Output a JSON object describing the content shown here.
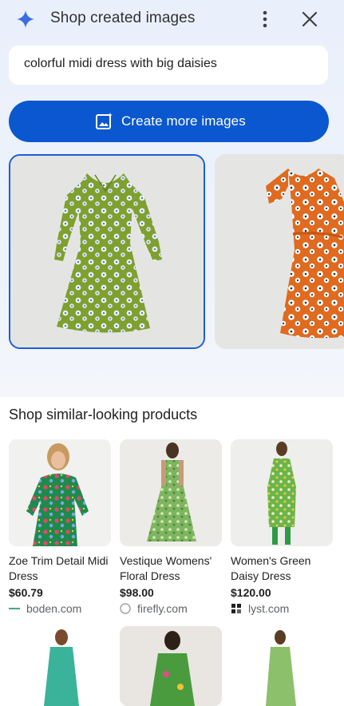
{
  "header": {
    "title": "Shop created images",
    "icons": {
      "sparkle": "gemini-sparkle-icon",
      "more": "more-vert-icon",
      "close": "close-icon"
    }
  },
  "prompt": {
    "value": "colorful midi dress with big daisies"
  },
  "create_button": {
    "label": "Create more images",
    "icon": "add-image-icon"
  },
  "generated_images": [
    {
      "description_name": "green-daisy-dress-image",
      "selected": true
    },
    {
      "description_name": "orange-daisy-dress-image",
      "selected": false
    }
  ],
  "similar": {
    "title": "Shop similar-looking products",
    "products": [
      {
        "name": "Zoe Trim Detail Midi Dress",
        "price": "$60.79",
        "source": "boden.com"
      },
      {
        "name": "Vestique Womens' Floral Dress",
        "price": "$98.00",
        "source": "firefly.com"
      },
      {
        "name": "Women's Green Daisy Dress",
        "price": "$120.00",
        "source": "lyst.com"
      }
    ]
  },
  "colors": {
    "accent": "#0b57d0",
    "selected_border": "#1a5fd6",
    "panel_bg": "#eaf0fb"
  }
}
